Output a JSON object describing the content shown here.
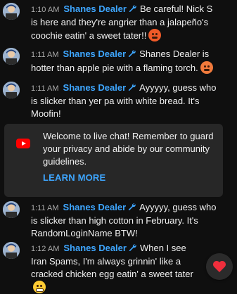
{
  "messages": [
    {
      "time": "1:10 AM",
      "author": "Shanes Dealer",
      "text": "Be careful! Nick S is here and they're angrier than a jalapeño's coochie eatin' a sweet tater!!",
      "emoji": "angry-face"
    },
    {
      "time": "1:11 AM",
      "author": "Shanes Dealer",
      "text": "Shanes Dealer is hotter than apple pie with a flaming torch.",
      "emoji": "hot-face"
    },
    {
      "time": "1:11 AM",
      "author": "Shanes Dealer",
      "text": "Ayyyyy, guess who is slicker than yer pa with white bread. It's Moofin!",
      "emoji": ""
    },
    {
      "time": "1:11 AM",
      "author": "Shanes Dealer",
      "text": "Ayyyyy, guess who is slicker than high cotton in February. It's RandomLoginName BTW!",
      "emoji": ""
    },
    {
      "time": "1:12 AM",
      "author": "Shanes Dealer",
      "text": "When I see Iran Spams, I'm always grinnin' like a cracked chicken egg eatin' a sweet tater",
      "emoji": "grinning-face"
    }
  ],
  "banner": {
    "text": "Welcome to live chat! Remember to guard your privacy and abide by our community guidelines.",
    "button": "LEARN MORE"
  },
  "icons": {
    "moderator": "wrench-icon",
    "banner": "youtube-icon",
    "reaction": "heart-icon"
  },
  "colors": {
    "author": "#3ea6ff",
    "background": "#0f0f0f",
    "banner_bg": "#272727",
    "timestamp": "#aaaaaa"
  }
}
